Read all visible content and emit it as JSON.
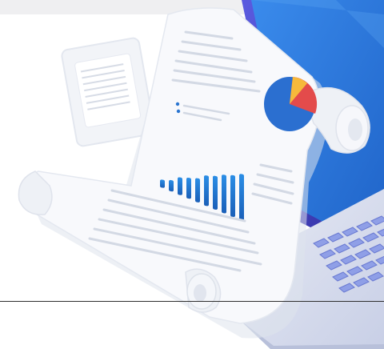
{
  "scene": {
    "description_icon": "document-report-illustration",
    "colors": {
      "background": "#ffffff",
      "paper": "#f7f8fb",
      "paper_shadow": "#dfe3ec",
      "text_lines": "#d5dae5",
      "chart_blue": "#1f7fd0",
      "chart_light_blue": "#48b6ee",
      "pie_blue": "#2b6fd0",
      "pie_red": "#e34b4b",
      "pie_yellow": "#f6b93b",
      "laptop_dark": "#3d3aa8",
      "laptop_screen": "#2b78d6",
      "keyboard": "#8f9fe7"
    }
  }
}
